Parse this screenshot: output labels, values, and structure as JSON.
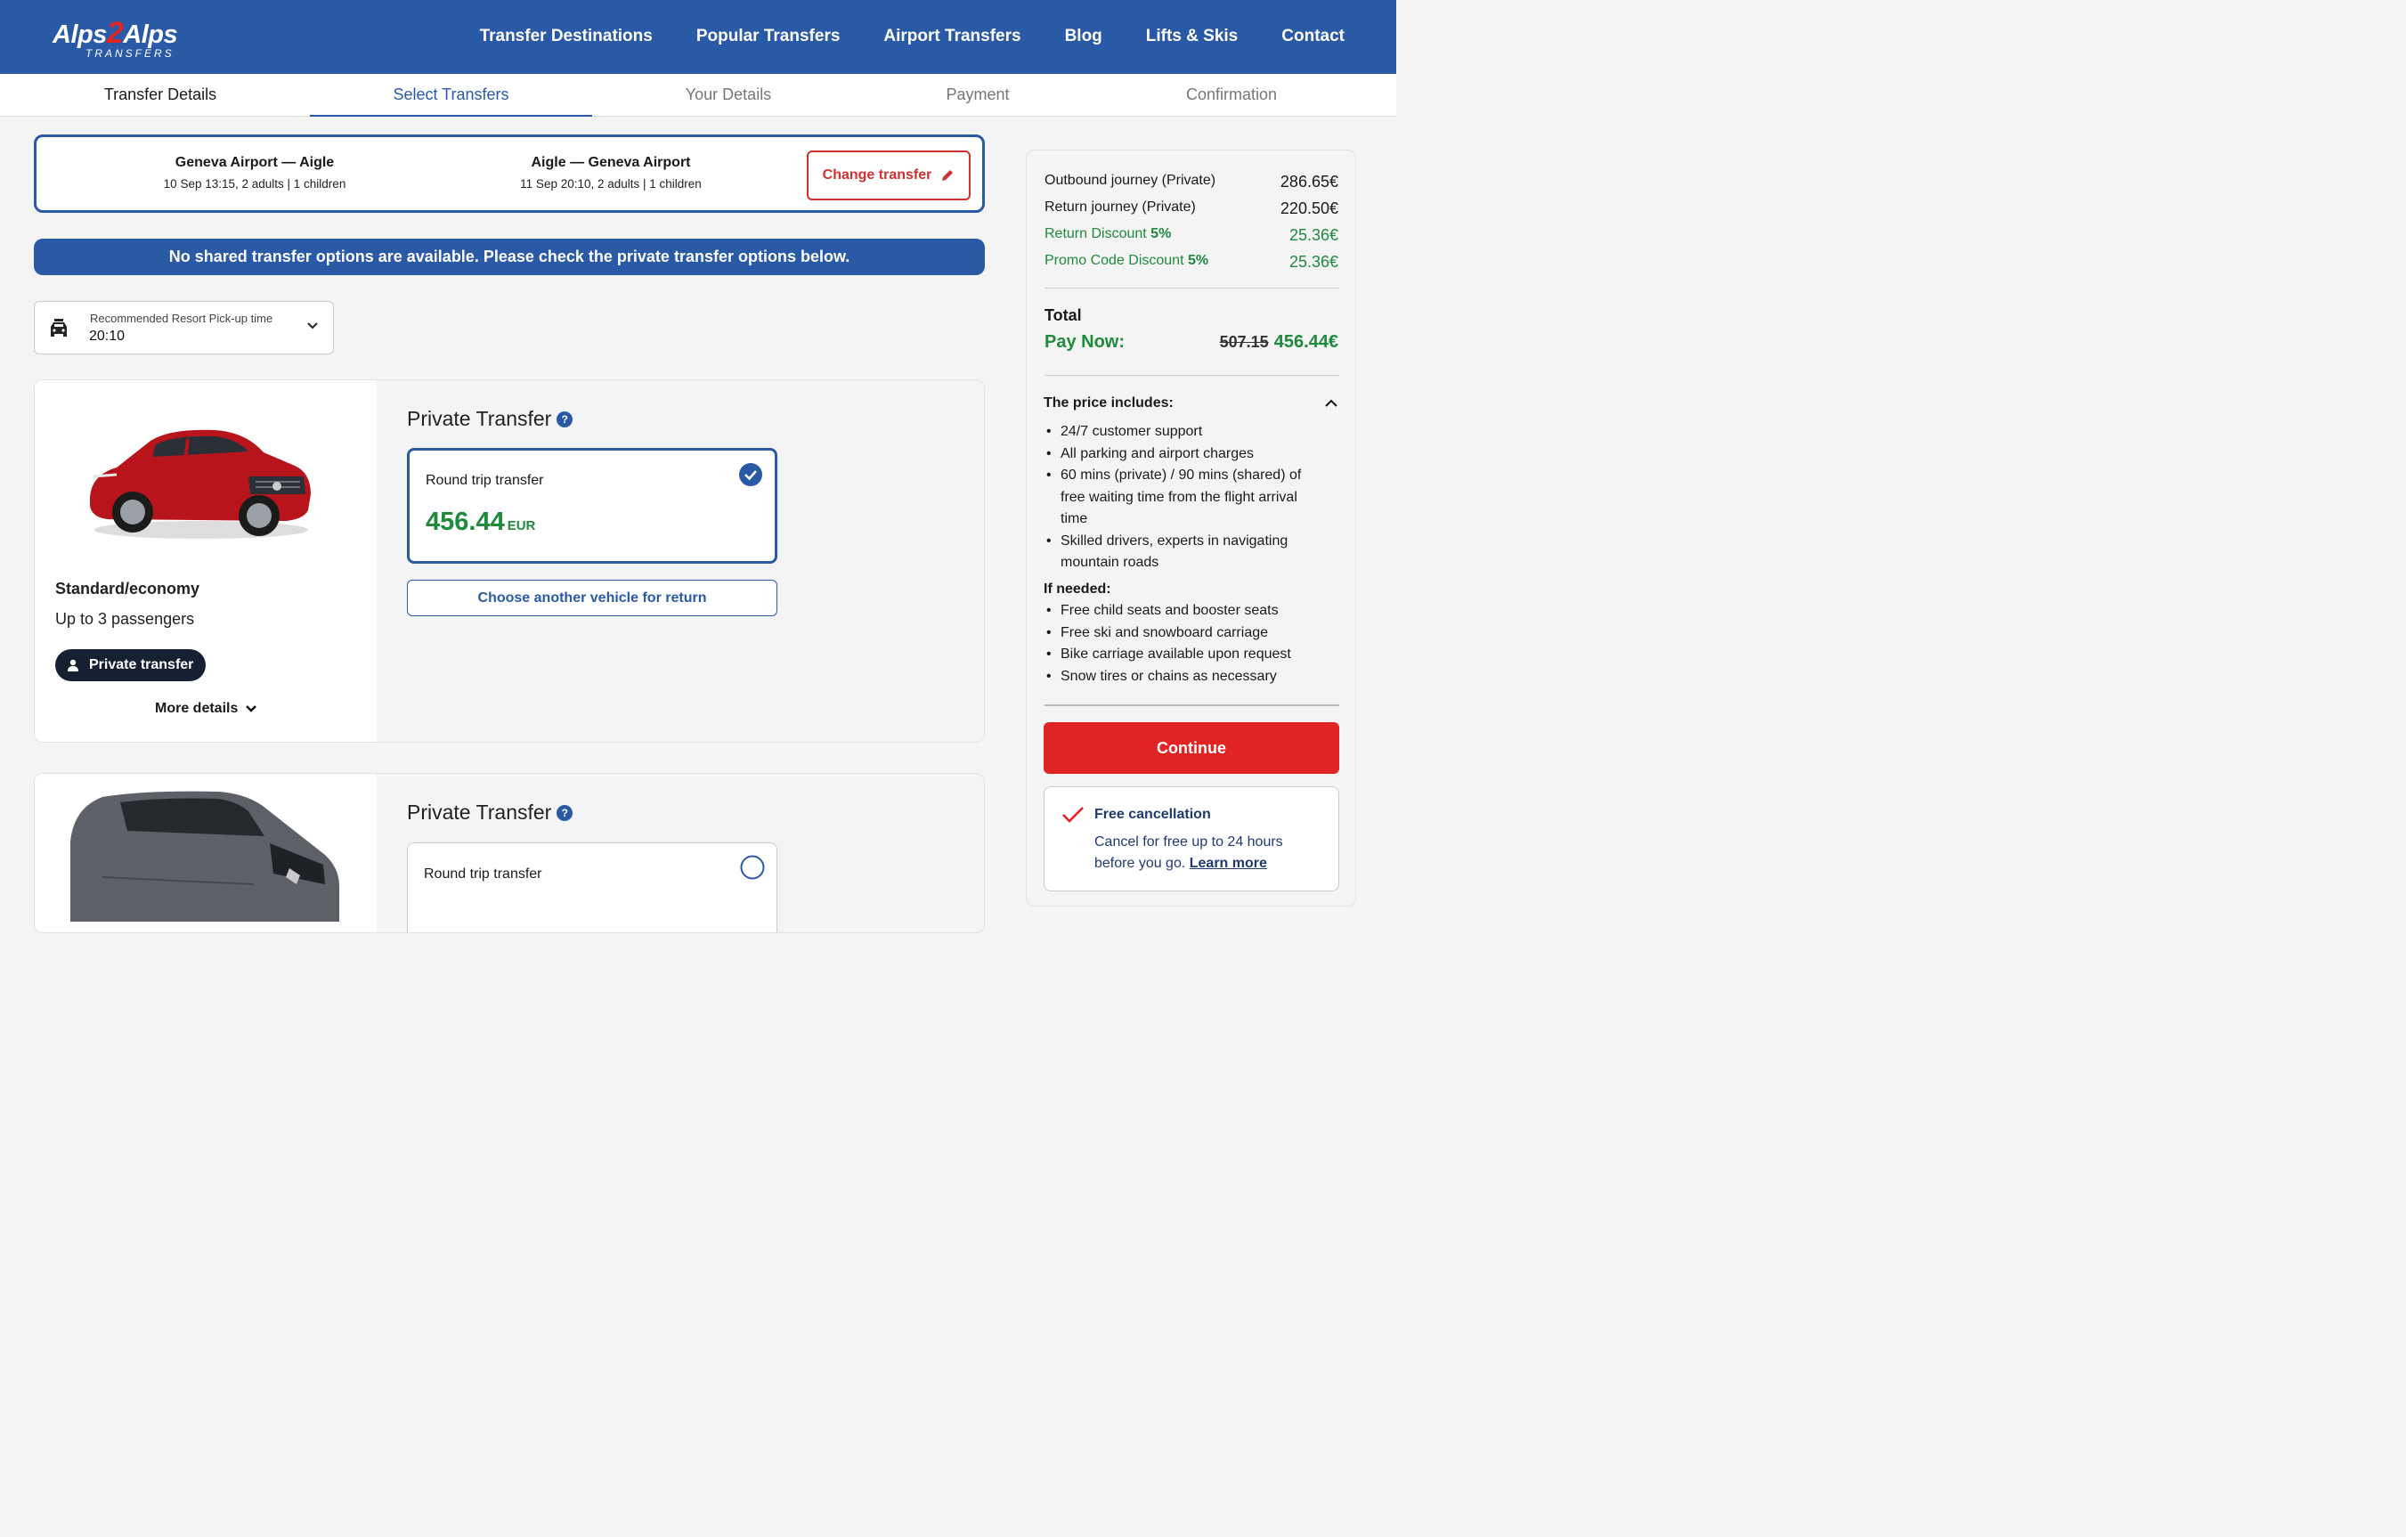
{
  "header": {
    "logo_left": "Alps",
    "logo_mid": "2",
    "logo_right": "Alps",
    "logo_sub": "TRANSFERS",
    "nav": [
      "Transfer Destinations",
      "Popular Transfers",
      "Airport Transfers",
      "Blog",
      "Lifts & Skis",
      "Contact"
    ]
  },
  "steps": [
    "Transfer Details",
    "Select Transfers",
    "Your Details",
    "Payment",
    "Confirmation"
  ],
  "summary": {
    "outbound_route": "Geneva Airport — Aigle",
    "outbound_meta": "10 Sep 13:15, 2 adults | 1 children",
    "return_route": "Aigle — Geneva Airport",
    "return_meta": "11 Sep 20:10, 2 adults | 1 children",
    "change_label": "Change transfer"
  },
  "notice": "No shared transfer options are available. Please check the private transfer options below.",
  "pickup": {
    "label": "Recommended Resort Pick-up time",
    "value": "20:10"
  },
  "vehicles": [
    {
      "title": "Private Transfer",
      "option_label": "Round trip transfer",
      "price": "456.44",
      "currency": "EUR",
      "another_label": "Choose another vehicle for return",
      "class": "Standard/economy",
      "passengers": "Up to 3 passengers",
      "badge": "Private transfer",
      "more": "More details"
    },
    {
      "title": "Private Transfer",
      "option_label": "Round trip transfer"
    }
  ],
  "panel": {
    "rows": [
      {
        "label": "Outbound journey (Private)",
        "amount": "286.65€"
      },
      {
        "label": "Return journey (Private)",
        "amount": "220.50€"
      },
      {
        "label": "Return Discount ",
        "pct": "5%",
        "amount": "25.36€"
      },
      {
        "label": "Promo Code Discount ",
        "pct": "5%",
        "amount": "25.36€"
      }
    ],
    "total_label": "Total",
    "pay_now_label": "Pay Now:",
    "old_price": "507.15",
    "new_price": "456.44€",
    "includes_title": "The price includes:",
    "includes": [
      "24/7 customer support",
      "All parking and airport charges",
      "60 mins (private) / 90 mins (shared) of free waiting time from the flight arrival time",
      "Skilled drivers, experts in navigating mountain roads"
    ],
    "if_needed_title": "If needed:",
    "if_needed": [
      "Free child seats and booster seats",
      "Free ski and snowboard carriage",
      "Bike carriage available upon request",
      "Snow tires or chains as necessary"
    ],
    "continue_label": "Continue",
    "cancel_title": "Free cancellation",
    "cancel_text": "Cancel for free up to 24 hours before you go. ",
    "cancel_link": "Learn more"
  },
  "colors": {
    "brand_blue": "#2a5aa6",
    "accent_red": "#e02424",
    "price_green": "#1e8a3c"
  }
}
